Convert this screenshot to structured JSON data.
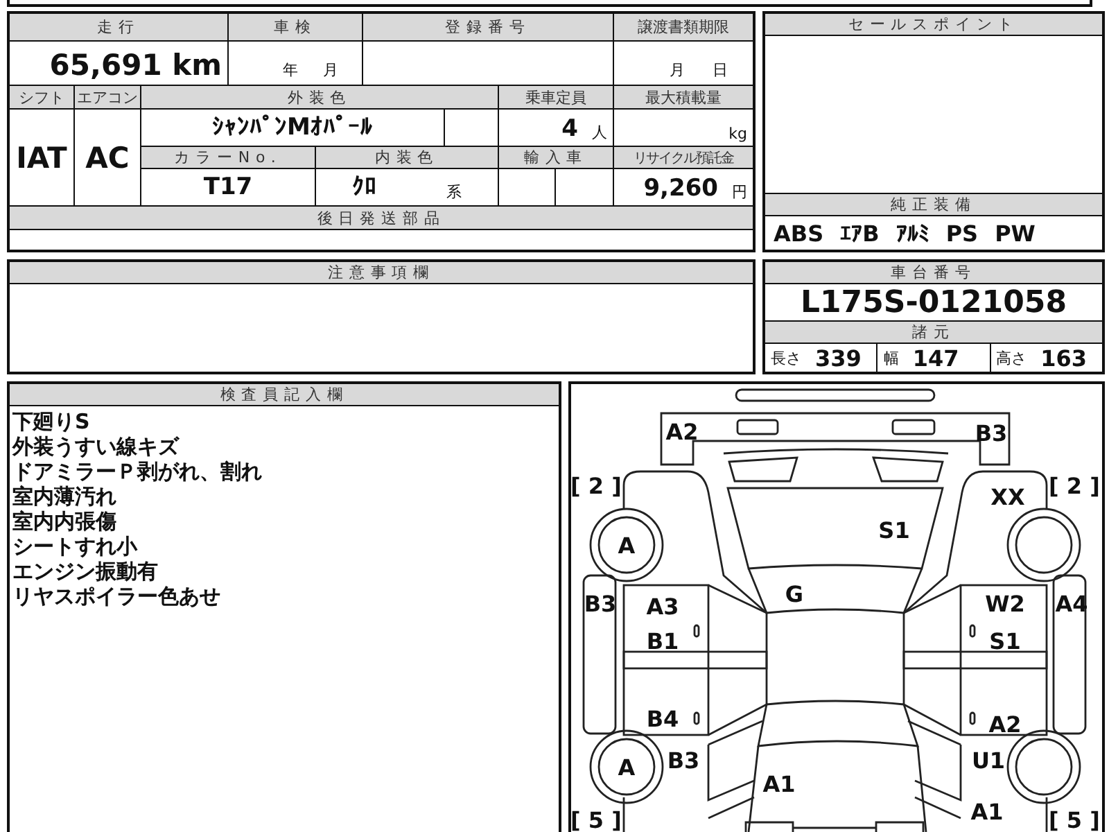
{
  "vehicle_table": {
    "mileage_header": "走行",
    "mileage": "65,691",
    "mileage_unit": "km",
    "inspection_header": "車検",
    "inspection_year_unit": "年",
    "inspection_month_unit": "月",
    "registration_header": "登録番号",
    "transfer_deadline_header": "譲渡書類期限",
    "transfer_month_unit": "月",
    "transfer_day_unit": "日",
    "shift_header": "シフト",
    "shift": "IAT",
    "ac_header": "エアコン",
    "ac": "AC",
    "exterior_color_header": "外装色",
    "exterior_color": "ｼｬﾝﾊﾟﾝMｵﾊﾟｰﾙ",
    "capacity_header": "乗車定員",
    "capacity": "4",
    "capacity_unit": "人",
    "max_load_header": "最大積載量",
    "max_load_unit": "kg",
    "color_no_header": "カラーNo.",
    "color_no": "T17",
    "interior_color_header": "内装色",
    "interior_color": "ｸﾛ",
    "interior_color_suffix": "系",
    "import_header": "輸入車",
    "recycle_header": "リサイクル預託金",
    "recycle_fee": "9,260",
    "recycle_unit": "円",
    "later_parts_header": "後日発送部品"
  },
  "sales_point": {
    "header": "セールスポイント"
  },
  "equipment": {
    "header": "純正装備",
    "items": [
      "ABS",
      "ｴｱB",
      "ｱﾙﾐ",
      "PS",
      "PW"
    ]
  },
  "notes_box": {
    "header": "注意事項欄"
  },
  "chassis": {
    "header": "車台番号",
    "number": "L175S-0121058"
  },
  "specs": {
    "header": "諸元",
    "items": [
      {
        "label": "長さ",
        "value": "339"
      },
      {
        "label": "幅",
        "value": "147"
      },
      {
        "label": "高さ",
        "value": "163"
      }
    ]
  },
  "inspector": {
    "header": "検査員記入欄",
    "lines": [
      "下廻りS",
      "外装うすい線キズ",
      "ドアミラーＰ剥がれ、割れ",
      "室内薄汚れ",
      "室内内張傷",
      "シートすれ小",
      "エンジン振動有",
      "リヤスポイラー色あせ"
    ]
  },
  "diagram": {
    "labels": [
      "A2",
      "B3",
      "[ 2 ]",
      "[ 2 ]",
      "XX",
      "S1",
      "A",
      "G",
      "B3",
      "A3",
      "B1",
      "W2",
      "A4",
      "S1",
      "B4",
      "A2",
      "A",
      "B3",
      "U1",
      "A1",
      "A1",
      "[ 5 ]",
      "[ 5 ]"
    ]
  }
}
